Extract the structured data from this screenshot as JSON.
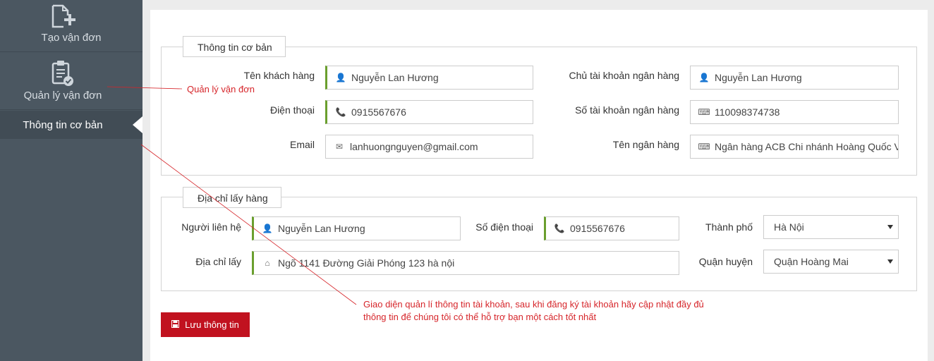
{
  "sidebar": {
    "items": [
      {
        "label": "Tạo vận đơn",
        "icon": "file-plus-icon"
      },
      {
        "label": "Quản lý vận đơn",
        "icon": "clipboard-check-icon"
      },
      {
        "label": "Thông tin cơ bản"
      }
    ]
  },
  "basic_info": {
    "legend": "Thông tin cơ bản",
    "customer_name": {
      "label": "Tên khách hàng",
      "value": "Nguyễn Lan Hương",
      "icon": "user-icon"
    },
    "phone": {
      "label": "Điện thoại",
      "value": "0915567676",
      "icon": "phone-icon"
    },
    "email": {
      "label": "Email",
      "value": "lanhuongnguyen@gmail.com",
      "icon": "envelope-icon"
    },
    "account_holder": {
      "label": "Chủ tài khoản ngân hàng",
      "value": "Nguyễn Lan Hương",
      "icon": "user-icon"
    },
    "account_number": {
      "label": "Số tài khoản ngân hàng",
      "value": "110098374738",
      "icon": "keyboard-icon"
    },
    "bank_name": {
      "label": "Tên ngân hàng",
      "value": "Ngân hàng ACB Chi nhánh Hoàng Quốc Việ",
      "icon": "keyboard-icon"
    }
  },
  "pickup": {
    "legend": "Địa chỉ lấy hàng",
    "contact": {
      "label": "Người liên hệ",
      "value": "Nguyễn Lan Hương",
      "icon": "user-icon"
    },
    "phone": {
      "label": "Số điện thoại",
      "value": "0915567676",
      "icon": "phone-icon"
    },
    "city": {
      "label": "Thành phố",
      "value": "Hà Nội"
    },
    "address": {
      "label": "Địa chỉ lấy",
      "value": "Ngõ 1141 Đường Giải Phóng 123 hà nội",
      "icon": "home-icon"
    },
    "district": {
      "label": "Quận huyện",
      "value": "Quận Hoàng Mai"
    }
  },
  "save_button": {
    "label": "Lưu thông tin",
    "icon": "floppy-disk-icon"
  },
  "annotations": {
    "manage": "Quản lý vận đơn",
    "info_line1": "Giao diện quản lí thông tin tài khoản, sau khi đăng ký tài khoản hãy cập nhật đầy đủ",
    "info_line2": "thông tin để chúng tôi có thể hỗ trợ bạn một cách tốt nhất"
  },
  "colors": {
    "sidebar_bg": "#4b5761",
    "accent_green": "#6a9f2e",
    "button_red": "#c1121f",
    "annotation_red": "#d6252a"
  }
}
